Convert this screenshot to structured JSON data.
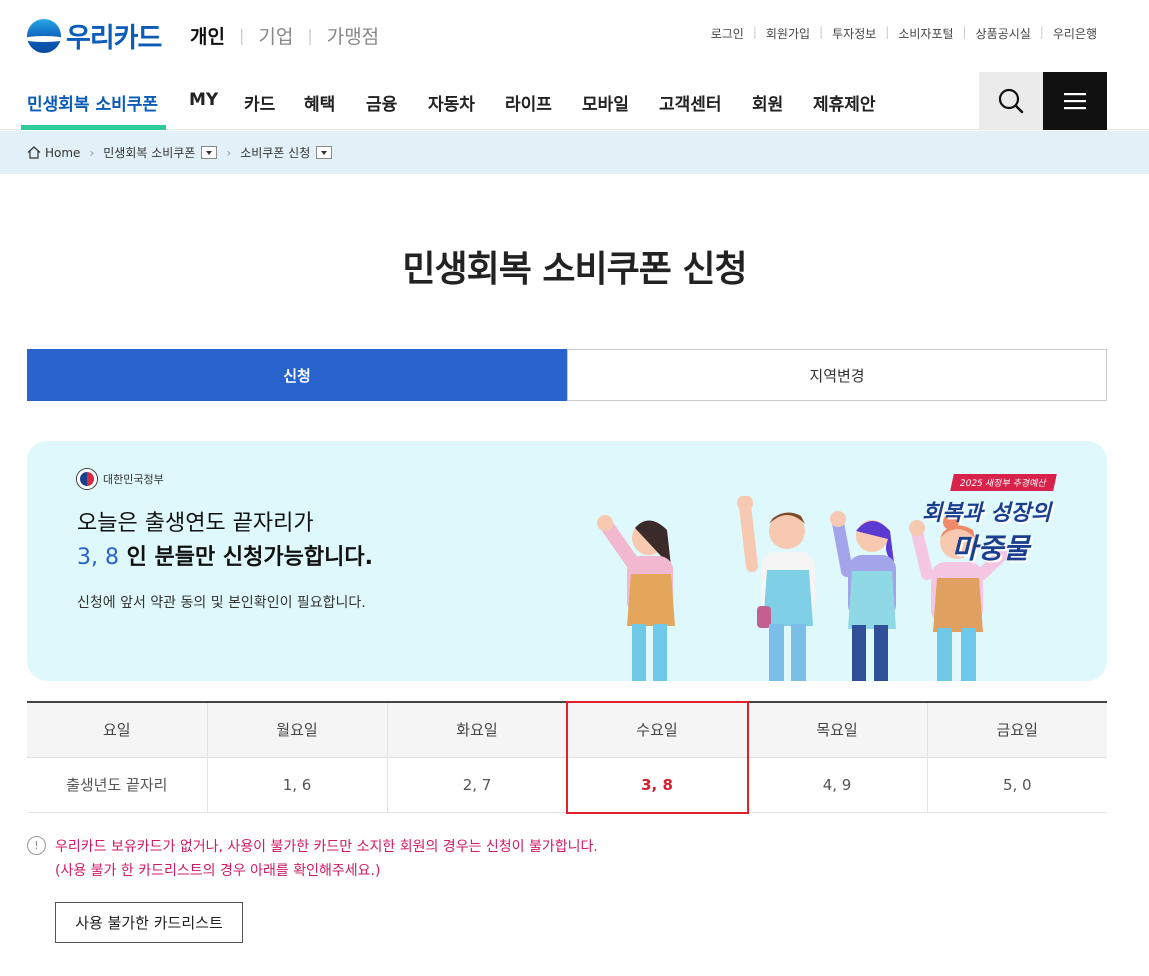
{
  "brand": {
    "name": "우리카드"
  },
  "segments": [
    {
      "label": "개인",
      "active": true
    },
    {
      "label": "기업",
      "active": false
    },
    {
      "label": "가맹점",
      "active": false
    }
  ],
  "util_links": [
    "로그인",
    "회원가입",
    "투자정보",
    "소비자포털",
    "상품공시실",
    "우리은행"
  ],
  "gnb": [
    "민생회복 소비쿠폰",
    "MY",
    "카드",
    "혜택",
    "금융",
    "자동차",
    "라이프",
    "모바일",
    "고객센터",
    "회원",
    "제휴제안"
  ],
  "breadcrumb": {
    "home": "Home",
    "level1": "민생회복 소비쿠폰",
    "level2": "소비쿠폰 신청"
  },
  "page_title": "민생회복 소비쿠폰 신청",
  "tabs": [
    {
      "label": "신청",
      "active": true
    },
    {
      "label": "지역변경",
      "active": false
    }
  ],
  "banner": {
    "gov_label": "대한민국정부",
    "line1": "오늘은 출생연도 끝자리가",
    "highlight_digits": "3, 8",
    "line2_rest": " 인 분들만 신청가능합니다.",
    "line3": "신청에 앞서 약관 동의 및 본인확인이 필요합니다.",
    "promo_tag": "2025 새정부 추경예산",
    "promo_line1": "회복과 성장의",
    "promo_line2": "마중물"
  },
  "schedule": {
    "header": [
      "요일",
      "월요일",
      "화요일",
      "수요일",
      "목요일",
      "금요일"
    ],
    "row": [
      "출생년도 끝자리",
      "1, 6",
      "2, 7",
      "3, 8",
      "4, 9",
      "5, 0"
    ],
    "highlight_index": 3
  },
  "notice": {
    "line1": "우리카드 보유카드가 없거나, 사용이 불가한 카드만 소지한 회원의 경우는 신청이 불가합니다.",
    "line2": "(사용 불가 한 카드리스트의 경우 아래를 확인해주세요.)"
  },
  "unusable_cards_button": "사용 불가한 카드리스트",
  "colors": {
    "brand_blue": "#0b5bb8",
    "tab_active": "#2862cc",
    "gnb_underline": "#2ecc9a",
    "highlight_red": "#d5202f",
    "notice_pink": "#d01a63",
    "breadcrumb_bg": "#e2f1f8",
    "banner_bg": "#dff8fb"
  }
}
